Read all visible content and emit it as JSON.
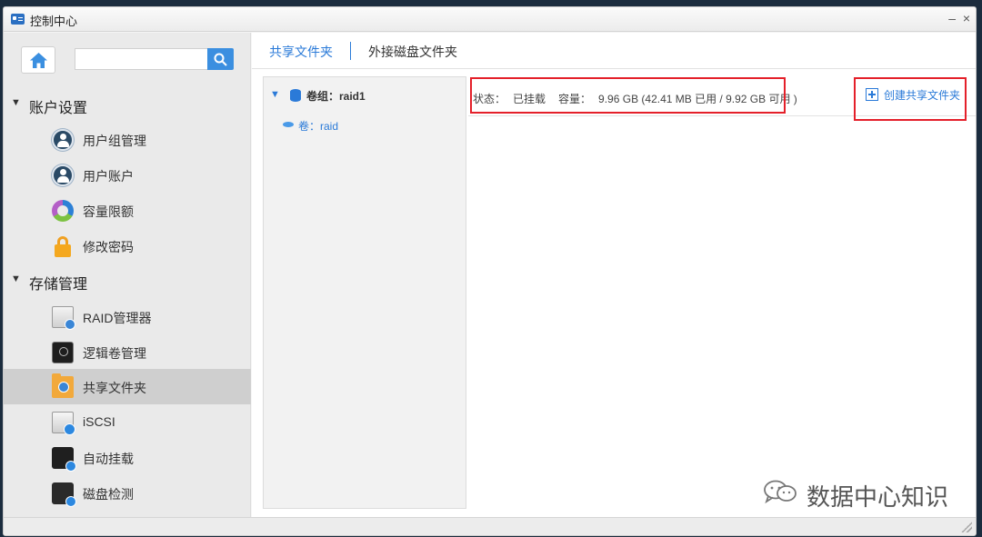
{
  "window": {
    "title": "控制中心",
    "minimize": "–",
    "close": "×"
  },
  "sidebar": {
    "search": {
      "placeholder": "",
      "value": ""
    },
    "sections": [
      {
        "title": "账户设置",
        "items": [
          {
            "label": "用户组管理",
            "icon": "user-group-icon"
          },
          {
            "label": "用户账户",
            "icon": "user-account-icon"
          },
          {
            "label": "容量限额",
            "icon": "quota-icon"
          },
          {
            "label": "修改密码",
            "icon": "lock-icon"
          }
        ]
      },
      {
        "title": "存储管理",
        "items": [
          {
            "label": "RAID管理器",
            "icon": "raid-icon"
          },
          {
            "label": "逻辑卷管理",
            "icon": "lvm-icon"
          },
          {
            "label": "共享文件夹",
            "icon": "shared-folder-icon",
            "active": true
          },
          {
            "label": "iSCSI",
            "icon": "iscsi-icon"
          },
          {
            "label": "自动挂载",
            "icon": "auto-mount-icon"
          },
          {
            "label": "磁盘检测",
            "icon": "disk-check-icon"
          }
        ]
      }
    ]
  },
  "main": {
    "tabs": [
      {
        "label": "共享文件夹",
        "active": true
      },
      {
        "label": "外接磁盘文件夹",
        "active": false
      }
    ],
    "tree": {
      "group_label": "卷组：raid1",
      "volume_label": "卷：raid"
    },
    "info": {
      "status_label": "状态：",
      "status_value": "已挂载",
      "capacity_label": "容量：",
      "capacity_value": "9.96 GB (42.41 MB 已用 / 9.92 GB 可用 )"
    },
    "create_button": "创建共享文件夹"
  },
  "watermark": "数据中心知识",
  "colors": {
    "accent": "#2a7ad8",
    "highlight_box": "#e4202a",
    "active_nav": "#cfcfcf"
  }
}
